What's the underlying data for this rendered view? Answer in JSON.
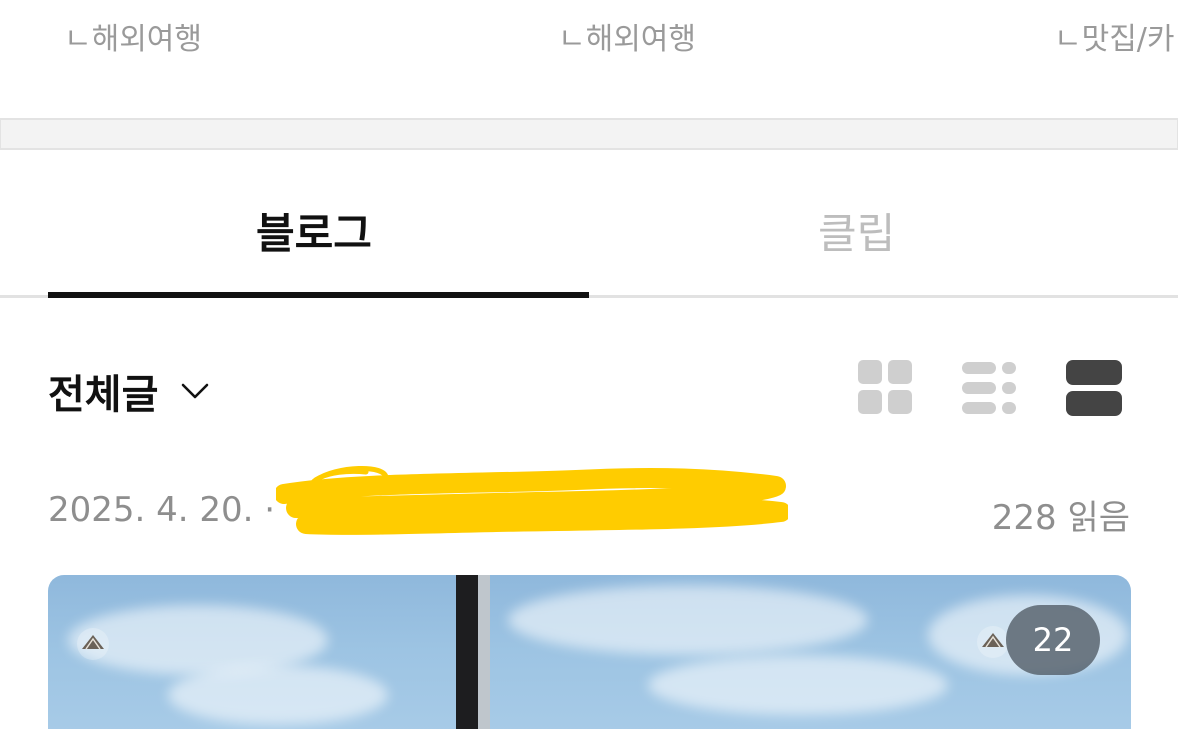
{
  "categories": [
    {
      "label": "ㄴ해외여행"
    },
    {
      "label": "ㄴ해외여행"
    },
    {
      "label": "ㄴ맛집/카"
    }
  ],
  "tabs": [
    {
      "label": "블로그",
      "active": true
    },
    {
      "label": "클립",
      "active": false
    }
  ],
  "filter": {
    "label": "전체글",
    "icon": "chevron-down-icon"
  },
  "view_modes": [
    {
      "name": "grid-view-icon",
      "active": false
    },
    {
      "name": "list-view-icon",
      "active": false
    },
    {
      "name": "card-view-icon",
      "active": true
    }
  ],
  "post": {
    "date": "2025. 4. 20. ·",
    "reads": "228 읽음",
    "photo_count": "22"
  },
  "colors": {
    "active_text": "#111111",
    "inactive_tab": "#bdbdbd",
    "meta_text": "#8e8e8e",
    "redaction": "#ffcc00"
  }
}
